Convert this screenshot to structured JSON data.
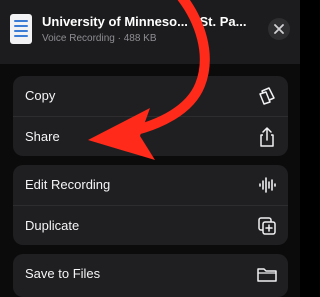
{
  "header": {
    "file_title": "University of Minneso... - St. Pa...",
    "file_subtitle": "Voice Recording · 488 KB",
    "file_icon": "document-icon",
    "close_icon": "close-icon"
  },
  "menu": {
    "groups": [
      {
        "items": [
          {
            "label": "Copy",
            "icon": "copy-icon"
          },
          {
            "label": "Share",
            "icon": "share-icon"
          }
        ]
      },
      {
        "items": [
          {
            "label": "Edit Recording",
            "icon": "waveform-icon"
          },
          {
            "label": "Duplicate",
            "icon": "duplicate-icon"
          }
        ]
      },
      {
        "items": [
          {
            "label": "Save to Files",
            "icon": "folder-icon"
          }
        ]
      }
    ]
  },
  "colors": {
    "background": "#0b0b0c",
    "panel": "#1f1f21",
    "text": "#f5f5f7",
    "subtext": "#8e8e93",
    "annotation_arrow": "#ff2a1a"
  }
}
